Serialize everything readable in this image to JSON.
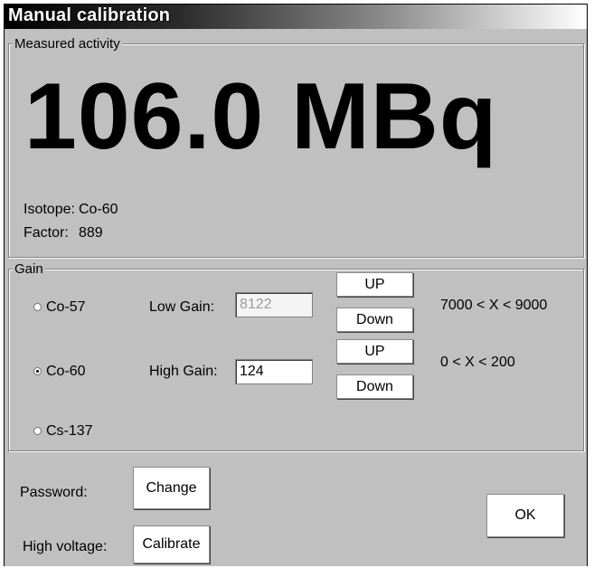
{
  "window": {
    "title": "Manual calibration"
  },
  "measured": {
    "legend": "Measured activity",
    "value": "106.0 MBq",
    "isotope_label": "Isotope:",
    "isotope_value": "Co-60",
    "factor_label": "Factor:",
    "factor_value": "889"
  },
  "gain": {
    "legend": "Gain",
    "radios": [
      {
        "label": "Co-57",
        "selected": false
      },
      {
        "label": "Co-60",
        "selected": true
      },
      {
        "label": "Cs-137",
        "selected": false
      }
    ],
    "low": {
      "label": "Low Gain:",
      "value": "8122",
      "up": "UP",
      "down": "Down",
      "range": "7000 < X < 9000"
    },
    "high": {
      "label": "High Gain:",
      "value": "124",
      "up": "UP",
      "down": "Down",
      "range": "0 < X < 200"
    }
  },
  "footer": {
    "password_label": "Password:",
    "change_button": "Change",
    "hv_label": "High voltage:",
    "calibrate_button": "Calibrate",
    "ok_button": "OK"
  }
}
